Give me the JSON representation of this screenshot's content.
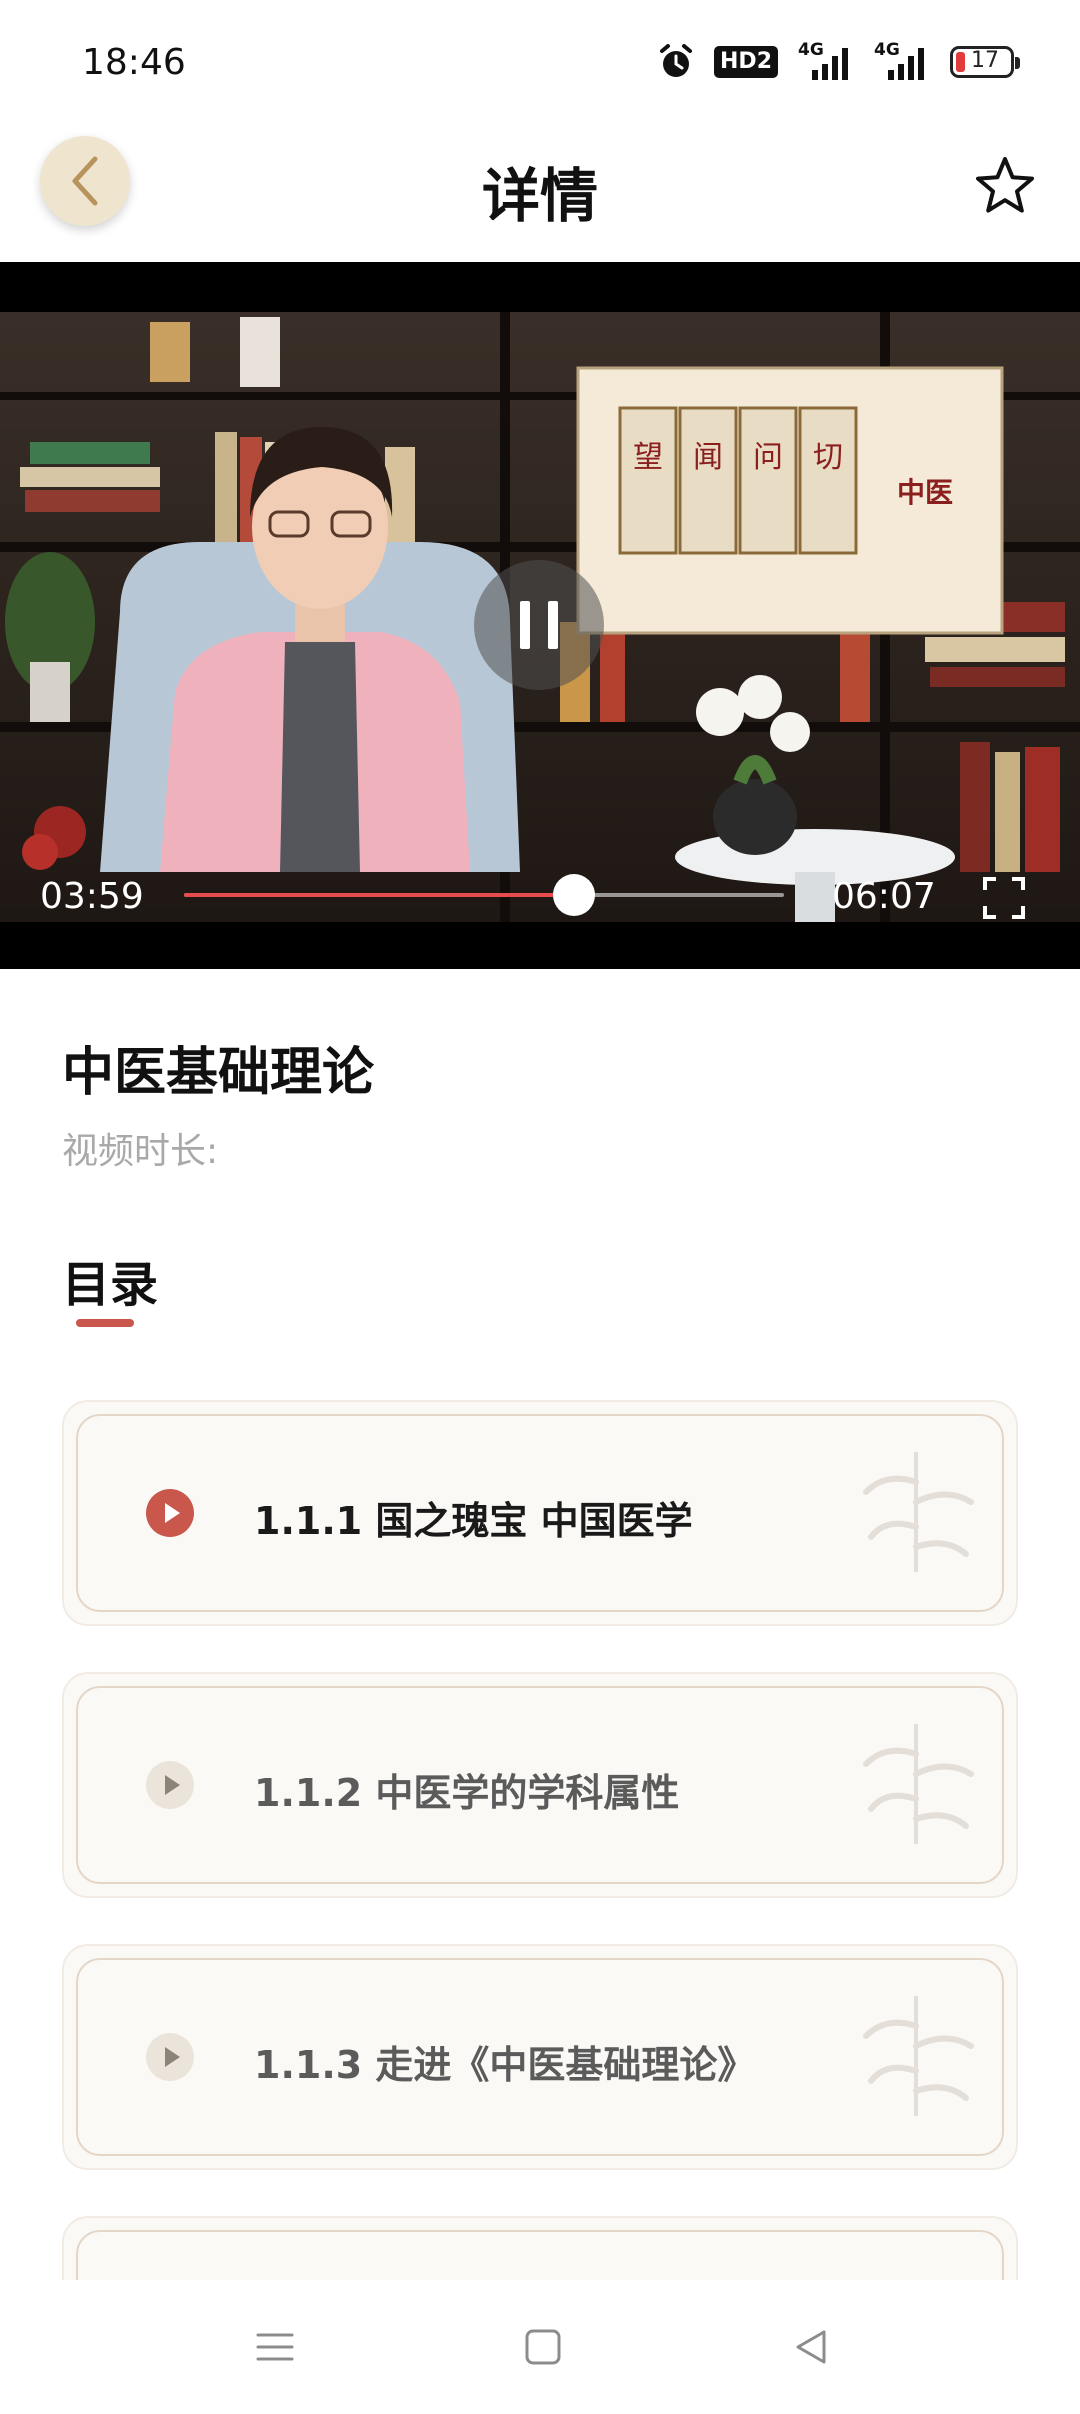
{
  "status_bar": {
    "time": "18:46",
    "hd_label": "HD2",
    "signal_1_label": "4G",
    "signal_2_label": "4G",
    "battery_level": "17",
    "battery_color": "#e23b3b"
  },
  "header": {
    "title": "详情",
    "back_icon": "chevron-left-icon",
    "favorite_icon": "star-outline-icon"
  },
  "video": {
    "current_time": "03:59",
    "total_time": "06:07",
    "progress": 0.65,
    "progress_color": "#e84b4b",
    "state": "playing",
    "board_caption": "中医",
    "scroll_labels": [
      "望",
      "闻",
      "问",
      "切"
    ]
  },
  "course": {
    "title": "中医基础理论",
    "duration_label": "视频时长:"
  },
  "catalog": {
    "title": "目录",
    "accent_color": "#c9574b",
    "items": [
      {
        "label": "1.1.1 国之瑰宝  中国医学",
        "active": true
      },
      {
        "label": "1.1.2 中医学的学科属性",
        "active": false
      },
      {
        "label": "1.1.3 走进《中医基础理论》",
        "active": false
      },
      {
        "label": "",
        "active": false
      }
    ]
  },
  "nav_bar": {
    "menu_icon": "menu-icon",
    "home_icon": "home-square-icon",
    "back_icon": "back-triangle-icon"
  }
}
